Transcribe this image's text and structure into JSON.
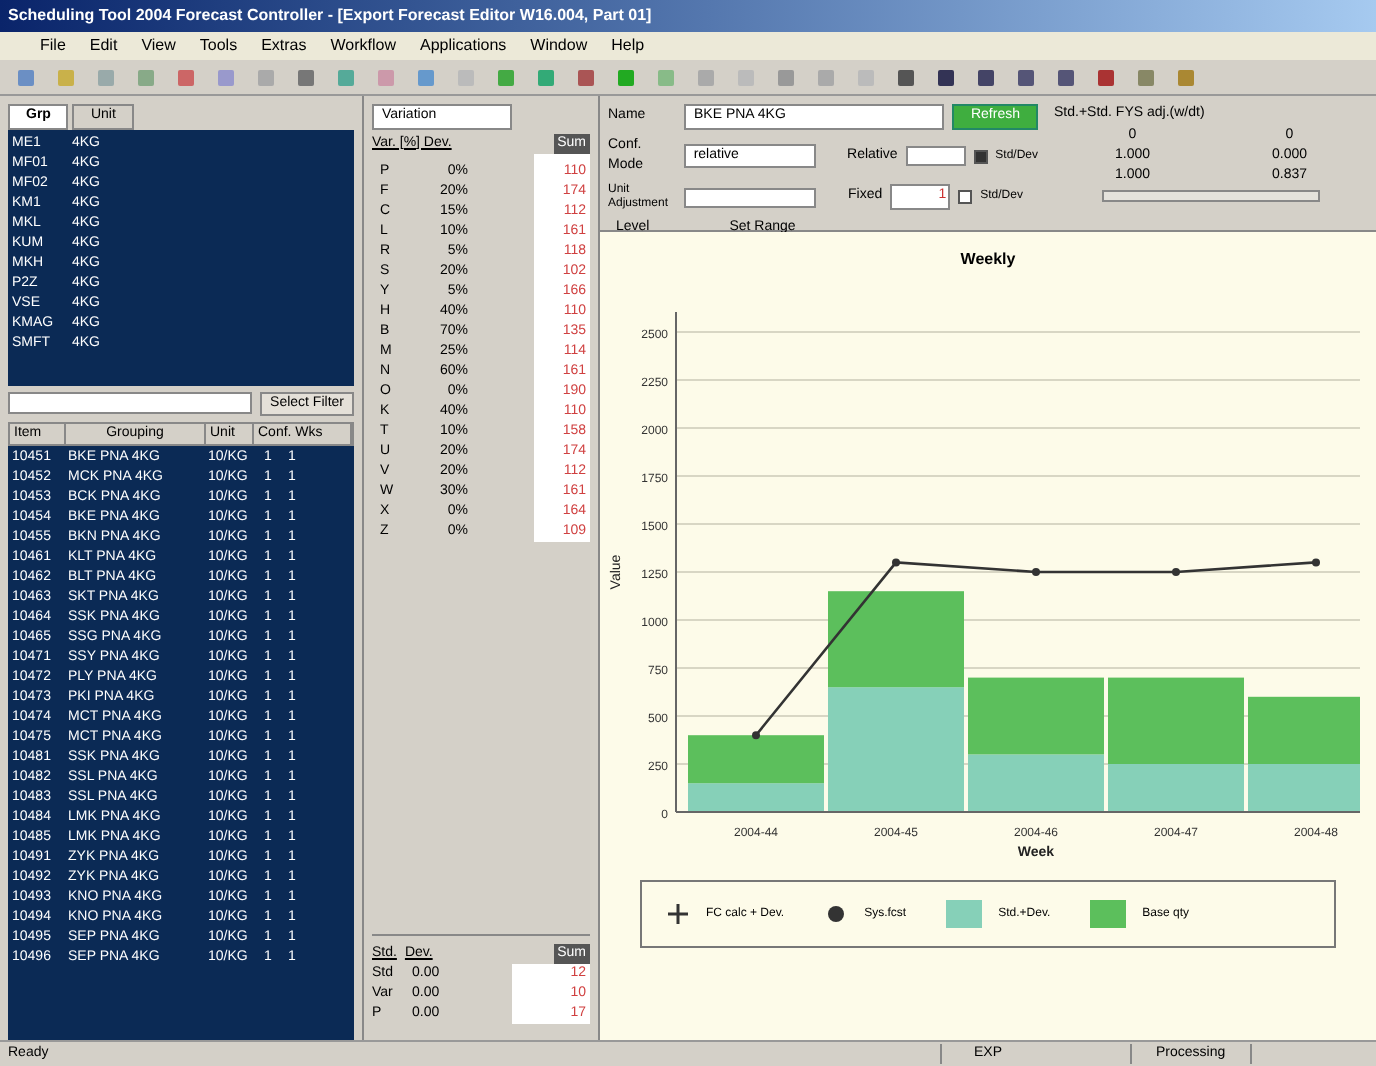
{
  "window": {
    "title": "Scheduling Tool 2004 Forecast Controller - [Export Forecast Editor W16.004, Part 01]"
  },
  "menu": [
    "File",
    "Edit",
    "View",
    "Tools",
    "Extras",
    "Workflow",
    "Applications",
    "Window",
    "Help"
  ],
  "top_list": {
    "tabs": [
      {
        "label": "Grp",
        "selected": true
      },
      {
        "label": "Unit",
        "selected": false
      }
    ],
    "rows": [
      [
        "ME1",
        "4KG"
      ],
      [
        "MF01",
        "4KG"
      ],
      [
        "MF02",
        "4KG"
      ],
      [
        "KM1",
        "4KG"
      ],
      [
        "MKL",
        "4KG"
      ],
      [
        "KUM",
        "4KG"
      ],
      [
        "MKH",
        "4KG"
      ],
      [
        "P2Z",
        "4KG"
      ],
      [
        "VSE",
        "4KG"
      ],
      [
        "KMAG",
        "4KG"
      ],
      [
        "SMFT",
        "4KG"
      ]
    ],
    "button": "Select Filter"
  },
  "item_list": {
    "columns": [
      "Item",
      "Grouping",
      "Unit",
      "Conf. Wks"
    ],
    "rows": [
      [
        "10451",
        "BKE PNA 4KG",
        "10/KG",
        "1",
        "1"
      ],
      [
        "10452",
        "MCK PNA 4KG",
        "10/KG",
        "1",
        "1"
      ],
      [
        "10453",
        "BCK PNA 4KG",
        "10/KG",
        "1",
        "1"
      ],
      [
        "10454",
        "BKE PNA 4KG",
        "10/KG",
        "1",
        "1"
      ],
      [
        "10455",
        "BKN PNA 4KG",
        "10/KG",
        "1",
        "1"
      ],
      [
        "10461",
        "KLT PNA 4KG",
        "10/KG",
        "1",
        "1"
      ],
      [
        "10462",
        "BLT PNA 4KG",
        "10/KG",
        "1",
        "1"
      ],
      [
        "10463",
        "SKT PNA 4KG",
        "10/KG",
        "1",
        "1"
      ],
      [
        "10464",
        "SSK PNA 4KG",
        "10/KG",
        "1",
        "1"
      ],
      [
        "10465",
        "SSG PNA 4KG",
        "10/KG",
        "1",
        "1"
      ],
      [
        "10471",
        "SSY PNA 4KG",
        "10/KG",
        "1",
        "1"
      ],
      [
        "10472",
        "PLY PNA 4KG",
        "10/KG",
        "1",
        "1"
      ],
      [
        "10473",
        "PKI PNA 4KG",
        "10/KG",
        "1",
        "1"
      ],
      [
        "10474",
        "MCT PNA 4KG",
        "10/KG",
        "1",
        "1"
      ],
      [
        "10475",
        "MCT PNA 4KG",
        "10/KG",
        "1",
        "1"
      ],
      [
        "10481",
        "SSK PNA 4KG",
        "10/KG",
        "1",
        "1"
      ],
      [
        "10482",
        "SSL PNA 4KG",
        "10/KG",
        "1",
        "1"
      ],
      [
        "10483",
        "SSL PNA 4KG",
        "10/KG",
        "1",
        "1"
      ],
      [
        "10484",
        "LMK PNA 4KG",
        "10/KG",
        "1",
        "1"
      ],
      [
        "10485",
        "LMK PNA 4KG",
        "10/KG",
        "1",
        "1"
      ],
      [
        "10491",
        "ZYK PNA 4KG",
        "10/KG",
        "1",
        "1"
      ],
      [
        "10492",
        "ZYK PNA 4KG",
        "10/KG",
        "1",
        "1"
      ],
      [
        "10493",
        "KNO PNA 4KG",
        "10/KG",
        "1",
        "1"
      ],
      [
        "10494",
        "KNO PNA 4KG",
        "10/KG",
        "1",
        "1"
      ],
      [
        "10495",
        "SEP PNA 4KG",
        "10/KG",
        "1",
        "1"
      ],
      [
        "10496",
        "SEP PNA 4KG",
        "10/KG",
        "1",
        "1"
      ]
    ]
  },
  "middle": {
    "dropdown": "Variation",
    "header": "Var. [%] Dev.",
    "sum_header": "Sum",
    "rows": [
      [
        "P",
        "0%",
        "110"
      ],
      [
        "F",
        "20%",
        "174"
      ],
      [
        "C",
        "15%",
        "112"
      ],
      [
        "L",
        "10%",
        "161"
      ],
      [
        "R",
        "5%",
        "118"
      ],
      [
        "S",
        "20%",
        "102"
      ],
      [
        "Y",
        "5%",
        "166"
      ],
      [
        "H",
        "40%",
        "110"
      ],
      [
        "B",
        "70%",
        "135"
      ],
      [
        "M",
        "25%",
        "114"
      ],
      [
        "N",
        "60%",
        "161"
      ],
      [
        "O",
        "0%",
        "190"
      ],
      [
        "K",
        "40%",
        "110"
      ],
      [
        "T",
        "10%",
        "158"
      ],
      [
        "U",
        "20%",
        "174"
      ],
      [
        "V",
        "20%",
        "112"
      ],
      [
        "W",
        "30%",
        "161"
      ],
      [
        "X",
        "0%",
        "164"
      ],
      [
        "Z",
        "0%",
        "109"
      ]
    ],
    "stats_headers": [
      "Std.",
      "Dev."
    ],
    "stats_sum": "Sum",
    "stats": [
      [
        "Std",
        "0.00",
        "12"
      ],
      [
        "Var",
        "0.00",
        "10"
      ],
      [
        "P",
        "0.00",
        "17"
      ]
    ]
  },
  "form": {
    "name_label": "Name",
    "name_value": "BKE PNA 4KG",
    "conf_label": "Conf. Mode",
    "conf_value": "relative",
    "unit_label": "Unit Adjustment",
    "relative_label": "Relative",
    "fixed_label": "Fixed",
    "fixed_value": "1",
    "refresh": "Refresh",
    "check_relative": {
      "label": "Std/Dev",
      "checked": true
    },
    "check_fixed": {
      "label": "Std/Dev",
      "checked": false
    },
    "stats_title": "Std.+Std. FYS adj.(w/dt)",
    "stats": [
      [
        "0",
        "0"
      ],
      [
        "1.000",
        "0.000"
      ],
      [
        "1.000",
        "0.837"
      ]
    ],
    "level_label": "Level",
    "range_label": "Set Range"
  },
  "chart": {
    "chart_data": {
      "type": "bar",
      "stacked": true,
      "grid": true,
      "title": "Weekly",
      "xlabel": "Week",
      "ylabel": "Value",
      "categories": [
        "2004-44",
        "2004-45",
        "2004-46",
        "2004-47",
        "2004-48"
      ],
      "ylim": [
        0,
        2500
      ],
      "yticks": [
        0,
        250,
        500,
        750,
        1000,
        1250,
        1500,
        1750,
        2000,
        2250,
        2500
      ],
      "series": [
        {
          "name": "Std.+Dev.",
          "color": "#86d0b8",
          "values": [
            150,
            650,
            300,
            250,
            250
          ]
        },
        {
          "name": "Base qty",
          "color": "#5cbf5c",
          "values": [
            250,
            500,
            400,
            450,
            350
          ]
        },
        {
          "name": "FC calc + Dev.",
          "type": "line",
          "marker": "circle",
          "color": "#333333",
          "values": [
            400,
            1300,
            1250,
            1250,
            1300
          ]
        }
      ]
    },
    "legend_extra": {
      "kind": "marker",
      "label": "Sys.fcst"
    }
  },
  "status_bar": [
    "Ready",
    "EXP",
    "Processing"
  ]
}
